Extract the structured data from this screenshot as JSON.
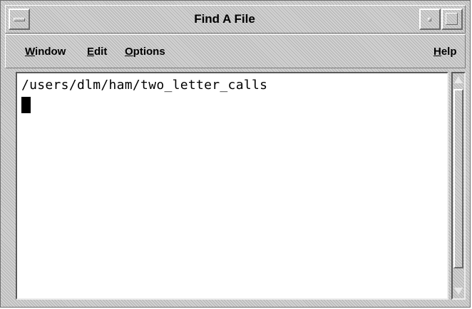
{
  "window": {
    "title": "Find A File"
  },
  "menubar": {
    "items": [
      {
        "label_mnemonic": "W",
        "label_rest": "indow"
      },
      {
        "label_mnemonic": "E",
        "label_rest": "dit"
      },
      {
        "label_mnemonic": "O",
        "label_rest": "ptions"
      },
      {
        "label_mnemonic": "H",
        "label_rest": "elp"
      }
    ]
  },
  "text_area": {
    "content": "/users/dlm/ham/two_letter_calls"
  },
  "scrollbar": {
    "position": 0.95
  },
  "icons": {
    "window_menu": "window-menu-icon",
    "minimize": "minimize-icon",
    "maximize": "maximize-icon",
    "scroll_up": "arrow-up-icon",
    "scroll_down": "arrow-down-icon"
  },
  "colors": {
    "frame": "#d2d2d2",
    "text_background": "#ffffff",
    "text": "#000000"
  }
}
